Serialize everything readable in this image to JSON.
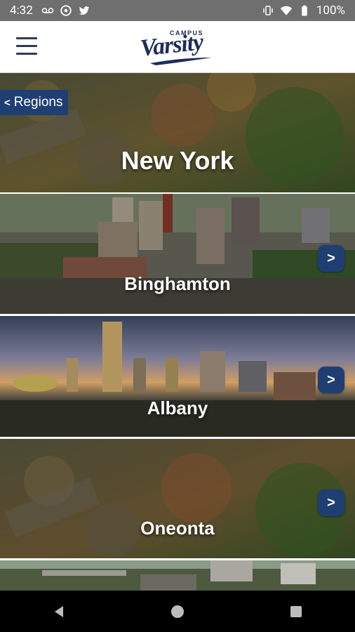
{
  "status_bar": {
    "time": "4:32",
    "battery": "100%",
    "left_icons": [
      "voicemail-icon",
      "circle-app-icon",
      "twitter-icon"
    ],
    "right_icons": [
      "vibrate-icon",
      "wifi-icon",
      "battery-icon"
    ]
  },
  "header": {
    "logo_small": "CAMPUS",
    "logo_main": "Varsity",
    "brand_color": "#1c2d5a"
  },
  "hero": {
    "back_label": "Regions",
    "title": "New York"
  },
  "cities": [
    {
      "name": "Binghamton",
      "arrow": ">"
    },
    {
      "name": "Albany",
      "arrow": ">"
    },
    {
      "name": "Oneonta",
      "arrow": ">"
    }
  ],
  "colors": {
    "accent": "#1f3f73",
    "statusbar": "#6f6f6f"
  }
}
